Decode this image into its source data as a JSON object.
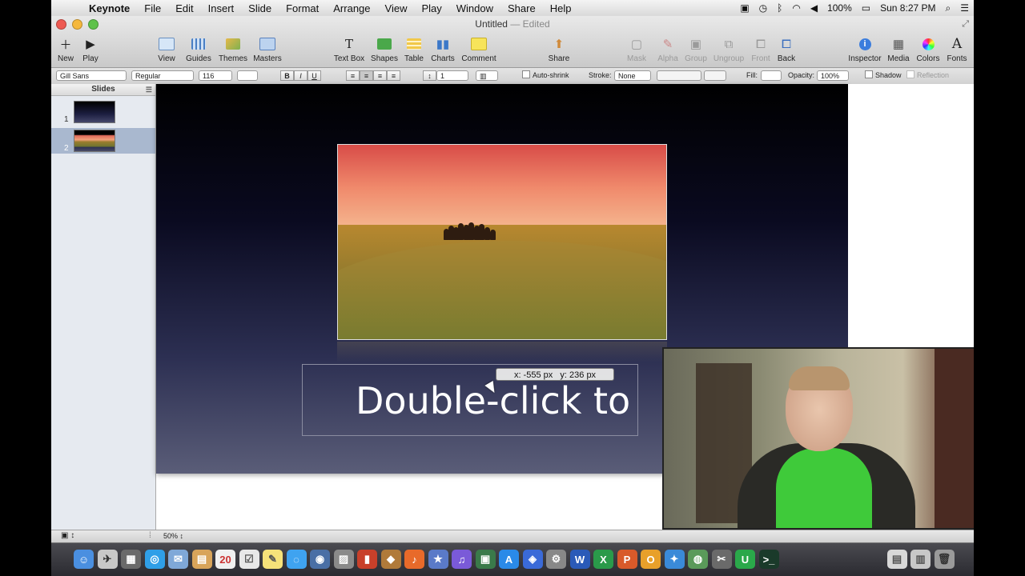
{
  "menubar": {
    "app": "Keynote",
    "items": [
      "File",
      "Edit",
      "Insert",
      "Slide",
      "Format",
      "Arrange",
      "View",
      "Play",
      "Window",
      "Share",
      "Help"
    ],
    "battery": "100%",
    "clock": "Sun 8:27 PM"
  },
  "window": {
    "title": "Untitled",
    "edited": "— Edited"
  },
  "toolbar": {
    "new": "New",
    "play": "Play",
    "view": "View",
    "guides": "Guides",
    "themes": "Themes",
    "masters": "Masters",
    "text_box": "Text Box",
    "shapes": "Shapes",
    "table": "Table",
    "charts": "Charts",
    "comment": "Comment",
    "share": "Share",
    "mask": "Mask",
    "alpha": "Alpha",
    "group": "Group",
    "ungroup": "Ungroup",
    "front": "Front",
    "back": "Back",
    "inspector": "Inspector",
    "media": "Media",
    "colors": "Colors",
    "fonts": "Fonts"
  },
  "format_bar": {
    "font_family": "Gill Sans",
    "font_style": "Regular",
    "font_size": "116",
    "bold": "B",
    "italic": "I",
    "underline": "U",
    "line_spacing": "1",
    "auto_shrink": "Auto-shrink",
    "stroke_label": "Stroke:",
    "stroke_value": "None",
    "fill_label": "Fill:",
    "opacity_label": "Opacity:",
    "opacity_value": "100%",
    "shadow": "Shadow",
    "reflection": "Reflection"
  },
  "navigator": {
    "header": "Slides",
    "slides": [
      {
        "number": "1"
      },
      {
        "number": "2"
      }
    ]
  },
  "slide": {
    "placeholder_text": "Double-click to",
    "coord_x": "x: -555 px",
    "coord_y": "y: 236 px"
  },
  "statusbar": {
    "zoom": "50%"
  },
  "colors": {
    "selected_slide": "#a9b8cf",
    "shirt_green": "#3fca3a"
  }
}
